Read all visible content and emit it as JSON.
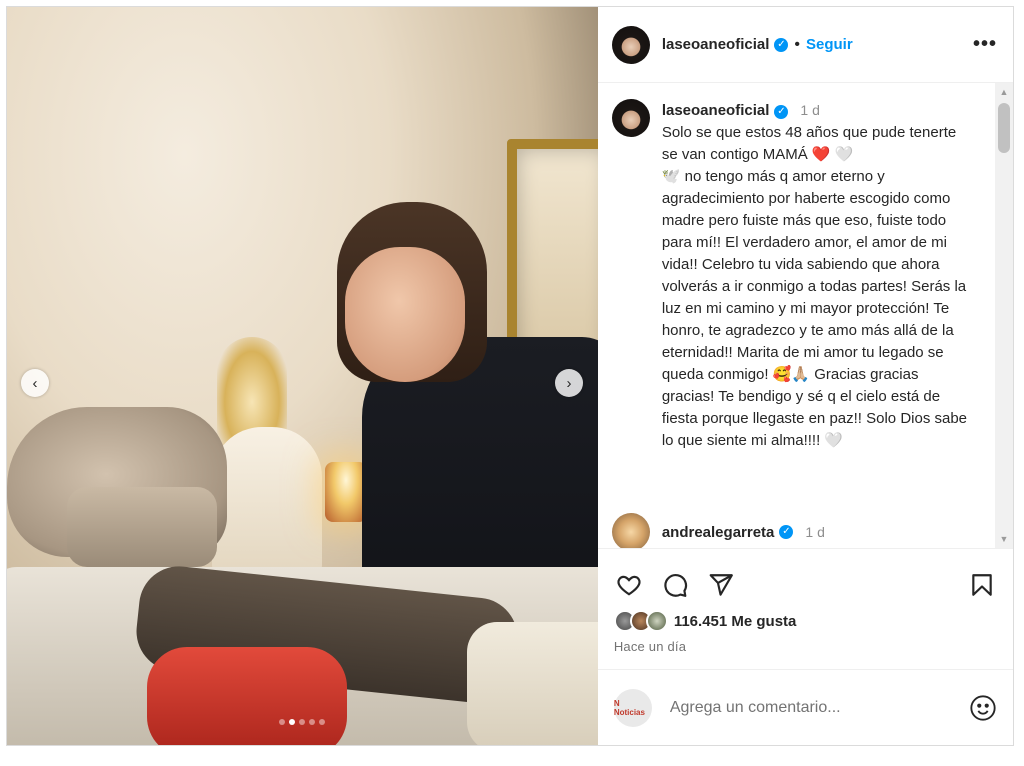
{
  "post": {
    "username": "laseoaneoficial",
    "verified_mark": "✓",
    "separator": "•",
    "follow_label": "Seguir",
    "more_label": "•••",
    "carousel": {
      "slides": 5,
      "active_index": 1,
      "prev_label": "‹",
      "next_label": "›"
    }
  },
  "caption": {
    "username": "laseoaneoficial",
    "time": "1 d",
    "text_part1": "Solo se que estos 48 años que pude tenerte se van contigo MAMÁ ",
    "heart_red": "❤️",
    "heart_white": " 🤍",
    "text_part2": "\n🕊️ no tengo más q amor eterno y agradecimiento por haberte escogido como madre pero fuiste más que eso, fuiste todo para mí!! El verdadero amor, el amor de mi vida!! Celebro tu vida sabiendo que ahora volverás a ir conmigo a todas partes! Serás la luz en mi camino y mi mayor protección! Te honro, te agradezco y te amo más allá de la eternidad!! Marita de mi amor tu legado se queda conmigo! 🥰🙏🏼 Gracias gracias gracias! Te bendigo y sé q el cielo está de fiesta porque llegaste en paz!! Solo Dios sabe lo que siente mi alma!!!! 🤍"
  },
  "comment": {
    "username": "andrealegarreta",
    "time": "1 d"
  },
  "scroll": {
    "up": "▲",
    "down": "▼"
  },
  "stats": {
    "likes": "116.451 Me gusta",
    "posted": "Hace un día"
  },
  "composer": {
    "placeholder": "Agrega un comentario...",
    "avatar_text": "N Noticias"
  },
  "icons": [
    "heart-icon",
    "comment-icon",
    "share-icon",
    "bookmark-icon",
    "emoji-icon"
  ],
  "colors": {
    "accent": "#0095f6",
    "text": "#262626",
    "muted": "#737373",
    "like_red": "#ed4956"
  }
}
